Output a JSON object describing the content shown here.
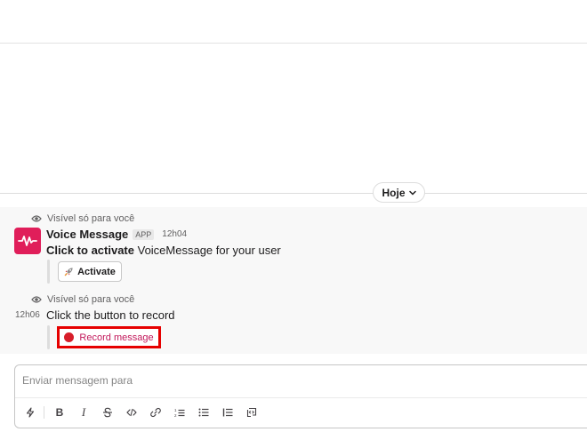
{
  "day_divider": {
    "label": "Hoje"
  },
  "messages": [
    {
      "visibility": "Visível só para você",
      "sender": "Voice Message",
      "badge": "APP",
      "time": "12h04",
      "text_bold": "Click to activate",
      "text_rest": " VoiceMessage for your user",
      "button_label": "Activate"
    },
    {
      "visibility": "Visível só para você",
      "time": "12h06",
      "text": "Click the button to record",
      "button_label": "Record message"
    }
  ],
  "composer": {
    "placeholder": "Enviar mensagem para",
    "toolbar": {
      "shortcuts_icon": "lightning-icon",
      "bold": "B",
      "italic": "I",
      "strike_icon": "strikethrough-icon",
      "code_icon": "code-icon",
      "link_icon": "link-icon",
      "ordered_list_icon": "ordered-list-icon",
      "bullet_list_icon": "bullet-list-icon",
      "blockquote_icon": "blockquote-icon",
      "codeblock_icon": "code-block-icon"
    }
  },
  "colors": {
    "avatar_bg": "#e01e5a",
    "record_highlight": "#e60000",
    "record_dot": "#d71e2a"
  }
}
